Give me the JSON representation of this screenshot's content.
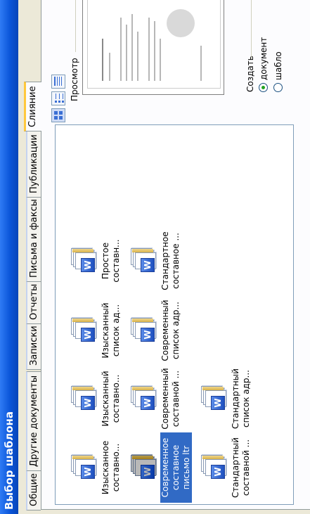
{
  "window": {
    "title": "Выбор шаблона"
  },
  "tabs": [
    {
      "label": "Общие",
      "active": false
    },
    {
      "label": "Другие документы",
      "active": false
    },
    {
      "label": "Записки",
      "active": false
    },
    {
      "label": "Отчеты",
      "active": false
    },
    {
      "label": "Письма и факсы",
      "active": false
    },
    {
      "label": "Публикации",
      "active": false
    },
    {
      "label": "Слияние",
      "active": true
    }
  ],
  "templates": [
    {
      "label": "Изысканное составно...",
      "icon": "word-template-icon",
      "selected": false
    },
    {
      "label": "Изысканный составно...",
      "icon": "word-template-icon",
      "selected": false
    },
    {
      "label": "Изысканный список ад...",
      "icon": "word-template-icon",
      "selected": false
    },
    {
      "label": "Простое составн...",
      "icon": "word-template-icon",
      "selected": false
    },
    {
      "label": "Современное составное письмо ltr",
      "icon": "word-template-icon",
      "selected": true
    },
    {
      "label": "Современный составной ...",
      "icon": "word-template-icon",
      "selected": false
    },
    {
      "label": "Современный список адр...",
      "icon": "word-template-icon",
      "selected": false
    },
    {
      "label": "Стандартное составное ...",
      "icon": "word-template-icon",
      "selected": false
    },
    {
      "label": "Стандартный составной ...",
      "icon": "word-template-icon",
      "selected": false
    },
    {
      "label": "Стандартный список адр...",
      "icon": "word-template-icon",
      "selected": false
    }
  ],
  "view_buttons": [
    {
      "name": "large-icons-view-icon",
      "active": true
    },
    {
      "name": "list-view-icon",
      "active": false
    },
    {
      "name": "details-view-icon",
      "active": false
    }
  ],
  "preview": {
    "label": "Просмотр"
  },
  "create": {
    "label": "Создать",
    "options": [
      {
        "label": "документ",
        "checked": true
      },
      {
        "label": "шабло",
        "checked": false
      }
    ]
  },
  "colors": {
    "title_bar": "#0a55d8",
    "selection": "#316ac5",
    "active_tab_accent": "#ffc83c",
    "dialog_bg": "#ece9d8"
  }
}
